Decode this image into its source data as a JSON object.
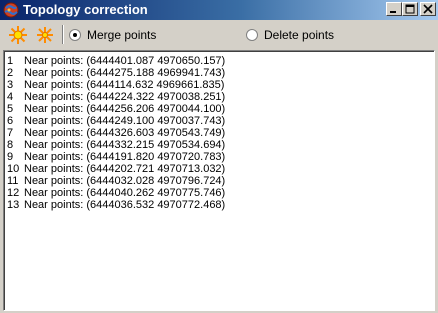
{
  "window": {
    "title": "Topology correction"
  },
  "toolbar": {
    "tool1_icon": "explode-points-icon",
    "tool2_icon": "collapse-points-icon",
    "merge_label": "Merge points",
    "delete_label": "Delete points",
    "merge_selected": true,
    "delete_selected": false
  },
  "list": {
    "items": [
      {
        "num": "1",
        "text": "Near points: (6444401.087 4970650.157)"
      },
      {
        "num": "2",
        "text": "Near points: (6444275.188 4969941.743)"
      },
      {
        "num": "3",
        "text": "Near points: (6444114.632 4969661.835)"
      },
      {
        "num": "4",
        "text": "Near points: (6444224.322 4970038.251)"
      },
      {
        "num": "5",
        "text": "Near points: (6444256.206 4970044.100)"
      },
      {
        "num": "6",
        "text": "Near points: (6444249.100 4970037.743)"
      },
      {
        "num": "7",
        "text": "Near points: (6444326.603 4970543.749)"
      },
      {
        "num": "8",
        "text": "Near points: (6444332.215 4970534.694)"
      },
      {
        "num": "9",
        "text": "Near points: (6444191.820 4970720.783)"
      },
      {
        "num": "10",
        "text": "Near points: (6444202.721 4970713.032)"
      },
      {
        "num": "11",
        "text": "Near points: (6444032.028 4970796.724)"
      },
      {
        "num": "12",
        "text": "Near points: (6444040.262 4970775.746)"
      },
      {
        "num": "13",
        "text": "Near points: (6444036.532 4970772.468)"
      }
    ]
  },
  "colors": {
    "titlebar_start": "#0a246a",
    "titlebar_end": "#a6caf0",
    "face": "#d4d0c8",
    "icon_orange": "#ff8c00",
    "icon_yellow": "#ffe000"
  }
}
